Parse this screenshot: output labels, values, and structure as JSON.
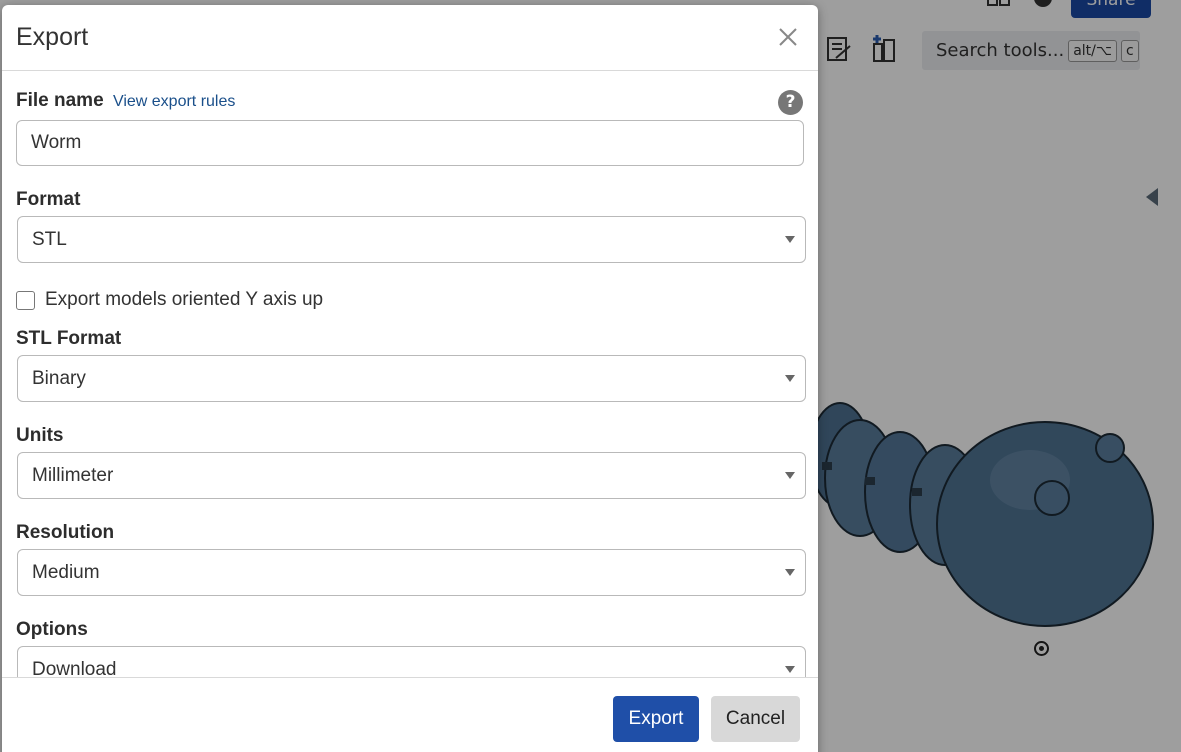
{
  "background": {
    "search": {
      "label": "Search tools...",
      "shortcut_1": "alt/⌥",
      "shortcut_2": "c"
    },
    "share_label": "Share"
  },
  "dialog": {
    "title": "Export",
    "file_name": {
      "label": "File name",
      "rules_link": "View export rules",
      "value": "Worm"
    },
    "format": {
      "label": "Format",
      "value": "STL"
    },
    "y_axis_checkbox": {
      "label": "Export models oriented Y axis up",
      "checked": false
    },
    "stl_format": {
      "label": "STL Format",
      "value": "Binary"
    },
    "units": {
      "label": "Units",
      "value": "Millimeter"
    },
    "resolution": {
      "label": "Resolution",
      "value": "Medium"
    },
    "options": {
      "label": "Options",
      "value": "Download"
    },
    "export_button": "Export",
    "cancel_button": "Cancel"
  },
  "colors": {
    "primary": "#1f4fa8",
    "link": "#1a4f8a",
    "model": "#4e7191"
  }
}
